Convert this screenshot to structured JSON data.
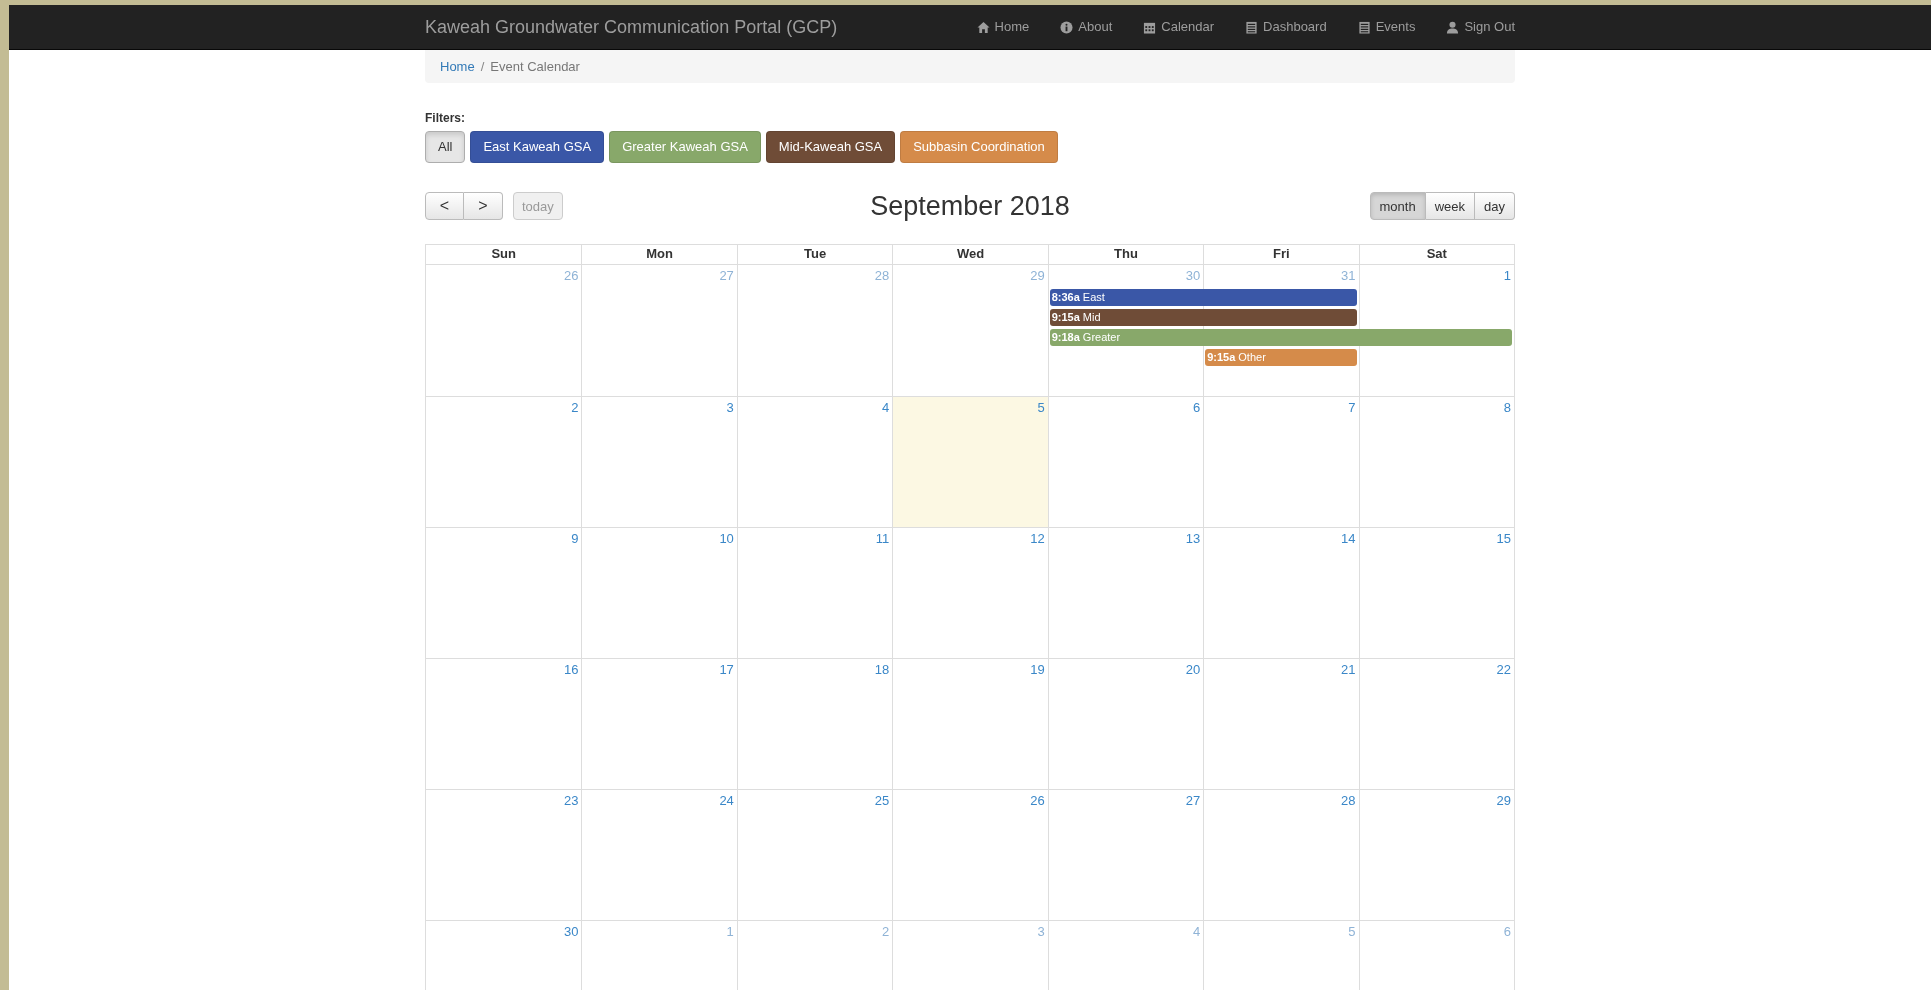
{
  "navbar": {
    "brand": "Kaweah Groundwater Communication Portal (GCP)",
    "items": [
      {
        "label": "Home"
      },
      {
        "label": "About"
      },
      {
        "label": "Calendar"
      },
      {
        "label": "Dashboard"
      },
      {
        "label": "Events"
      },
      {
        "label": "Sign Out"
      }
    ]
  },
  "breadcrumb": [
    {
      "label": "Home",
      "kind": "link"
    },
    {
      "label": "Event Calendar",
      "kind": "current",
      "separator": "/"
    }
  ],
  "filters": {
    "label": "Filters:",
    "buttons": [
      {
        "label": "All",
        "color": "#e6e6e6",
        "selected": true
      },
      {
        "label": "East Kaweah GSA",
        "color": "#3a57a7",
        "selected": false
      },
      {
        "label": "Greater Kaweah GSA",
        "color": "#88a86a",
        "selected": false
      },
      {
        "label": "Mid-Kaweah GSA",
        "color": "#6f4c37",
        "selected": false
      },
      {
        "label": "Subbasin Coordination",
        "color": "#d58b4a",
        "selected": false
      }
    ]
  },
  "calendar": {
    "title": "September 2018",
    "prev": "<",
    "next": ">",
    "today": "today",
    "views": [
      {
        "label": "month",
        "selected": true
      },
      {
        "label": "week",
        "selected": false
      },
      {
        "label": "day",
        "selected": false
      }
    ],
    "weekdays": [
      "Sun",
      "Mon",
      "Tue",
      "Wed",
      "Thu",
      "Fri",
      "Sat"
    ],
    "weeks": [
      {
        "days": [
          {
            "number": "26",
            "other_month": true,
            "today": false
          },
          {
            "number": "27",
            "other_month": true,
            "today": false
          },
          {
            "number": "28",
            "other_month": true,
            "today": false
          },
          {
            "number": "29",
            "other_month": true,
            "today": false
          },
          {
            "number": "30",
            "other_month": true,
            "today": false,
            "events": [
              {
                "time": "8:36a",
                "title": "East",
                "color": "#3a57a7",
                "continues": [
                  true
                ]
              },
              {
                "time": "9:15a",
                "title": "Mid",
                "color": "#6f4c37",
                "continues": [
                  true
                ]
              },
              {
                "time": "9:18a",
                "title": "Greater",
                "color": "#88a86a",
                "continues": [
                  true,
                  true
                ]
              }
            ]
          },
          {
            "number": "31",
            "other_month": true,
            "today": false,
            "events": [
              {
                "time": "9:15a",
                "title": "Other",
                "color": "#d58b4a"
              }
            ]
          },
          {
            "number": "1",
            "other_month": false,
            "today": false
          }
        ]
      },
      {
        "days": [
          {
            "number": "2",
            "other_month": false,
            "today": false
          },
          {
            "number": "3",
            "other_month": false,
            "today": false
          },
          {
            "number": "4",
            "other_month": false,
            "today": false
          },
          {
            "number": "5",
            "other_month": false,
            "today": true
          },
          {
            "number": "6",
            "other_month": false,
            "today": false
          },
          {
            "number": "7",
            "other_month": false,
            "today": false
          },
          {
            "number": "8",
            "other_month": false,
            "today": false
          }
        ]
      },
      {
        "days": [
          {
            "number": "9",
            "other_month": false,
            "today": false
          },
          {
            "number": "10",
            "other_month": false,
            "today": false
          },
          {
            "number": "11",
            "other_month": false,
            "today": false
          },
          {
            "number": "12",
            "other_month": false,
            "today": false
          },
          {
            "number": "13",
            "other_month": false,
            "today": false
          },
          {
            "number": "14",
            "other_month": false,
            "today": false
          },
          {
            "number": "15",
            "other_month": false,
            "today": false
          }
        ]
      },
      {
        "days": [
          {
            "number": "16",
            "other_month": false,
            "today": false
          },
          {
            "number": "17",
            "other_month": false,
            "today": false
          },
          {
            "number": "18",
            "other_month": false,
            "today": false
          },
          {
            "number": "19",
            "other_month": false,
            "today": false
          },
          {
            "number": "20",
            "other_month": false,
            "today": false
          },
          {
            "number": "21",
            "other_month": false,
            "today": false
          },
          {
            "number": "22",
            "other_month": false,
            "today": false
          }
        ]
      },
      {
        "days": [
          {
            "number": "23",
            "other_month": false,
            "today": false
          },
          {
            "number": "24",
            "other_month": false,
            "today": false
          },
          {
            "number": "25",
            "other_month": false,
            "today": false
          },
          {
            "number": "26",
            "other_month": false,
            "today": false
          },
          {
            "number": "27",
            "other_month": false,
            "today": false
          },
          {
            "number": "28",
            "other_month": false,
            "today": false
          },
          {
            "number": "29",
            "other_month": false,
            "today": false
          }
        ]
      },
      {
        "days": [
          {
            "number": "30",
            "other_month": false,
            "today": false
          },
          {
            "number": "1",
            "other_month": true,
            "today": false
          },
          {
            "number": "2",
            "other_month": true,
            "today": false
          },
          {
            "number": "3",
            "other_month": true,
            "today": false
          },
          {
            "number": "4",
            "other_month": true,
            "today": false
          },
          {
            "number": "5",
            "other_month": true,
            "today": false
          },
          {
            "number": "6",
            "other_month": true,
            "today": false
          }
        ]
      }
    ]
  }
}
